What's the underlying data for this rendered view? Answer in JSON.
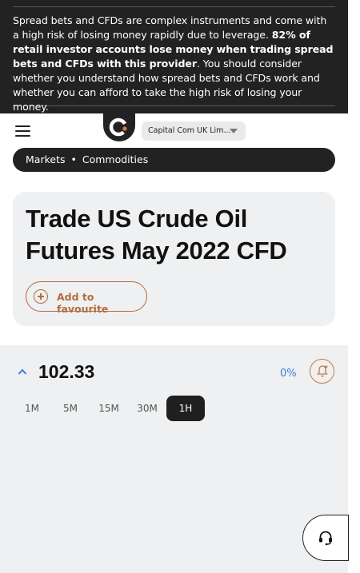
{
  "risk_warning": {
    "part1": "Spread bets and CFDs are complex instruments and come with a high risk of losing money rapidly due to leverage. ",
    "bold": "82% of retail investor accounts lose money when trading spread bets and CFDs with this provider",
    "part2": ". You should consider whether you understand how spread bets and CFDs work and whether you can afford to take the high risk of losing your money."
  },
  "header": {
    "entity_select": "Capital Com UK Lim..."
  },
  "breadcrumb": {
    "items": [
      "Markets",
      "Commodities"
    ],
    "separator": "•"
  },
  "instrument": {
    "title": "Trade US Crude Oil Futures May 2022 CFD",
    "favourite_label": "Add to favourite"
  },
  "quote": {
    "price": "102.33",
    "change": "0%"
  },
  "timeframes": {
    "items": [
      "1M",
      "5M",
      "15M",
      "30M",
      "1H"
    ],
    "active": "1H"
  },
  "icons": {
    "menu": "hamburger-menu-icon",
    "logo": "capital-com-logo",
    "expand": "chevron-up-icon",
    "alert": "bell-plus-icon",
    "support": "headset-icon"
  },
  "colors": {
    "banner_bg": "#222222",
    "accent_orange": "#b46c3d",
    "change_blue": "#3d7fd9",
    "panel_bg": "#eef0f1"
  }
}
